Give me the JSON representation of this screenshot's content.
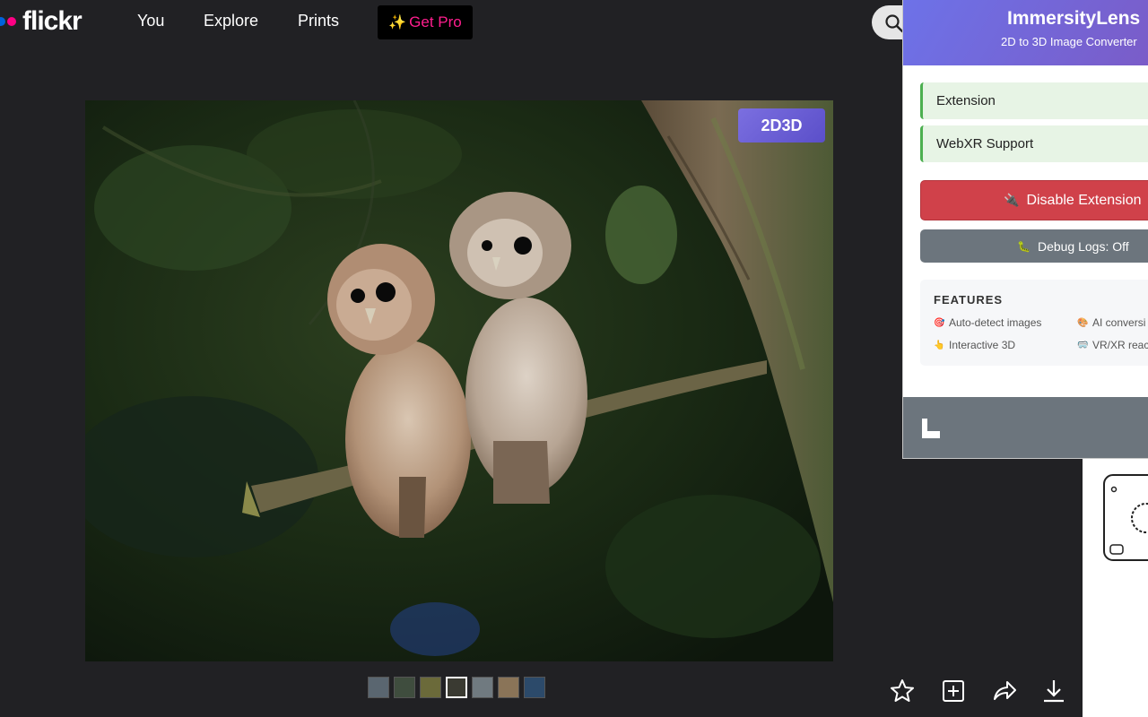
{
  "nav": {
    "logo_text": "flickr",
    "links": [
      "You",
      "Explore",
      "Prints"
    ],
    "get_pro": "Get Pro",
    "get_pro_icon": "sparkles-icon",
    "search_icon": "search-icon"
  },
  "photo": {
    "subject": "two owlets perched on a branch",
    "badge": "2D3D"
  },
  "thumbnails": {
    "count": 7,
    "selected_index": 3
  },
  "actions": [
    "star-icon",
    "add-to-gallery-icon",
    "share-icon",
    "download-icon"
  ],
  "extension": {
    "title": "ImmersityLens",
    "subtitle": "2D to 3D Image Converter",
    "status_rows": [
      "Extension",
      "WebXR Support"
    ],
    "disable_button": "Disable Extension",
    "disable_icon": "plug-icon",
    "debug_button": "Debug Logs: Off",
    "debug_icon": "bug-icon",
    "features_title": "FEATURES",
    "features": [
      {
        "icon": "target-icon",
        "label": "Auto-detect images"
      },
      {
        "icon": "palette-icon",
        "label": "AI conversi"
      },
      {
        "icon": "pointer-icon",
        "label": "Interactive 3D"
      },
      {
        "icon": "vr-headset-icon",
        "label": "VR/XR reac"
      }
    ]
  },
  "colors": {
    "flickr_blue": "#0063dc",
    "flickr_pink": "#ff0084",
    "get_pro_text": "#ff1e8e",
    "disable_red": "#d0414a",
    "debug_gray": "#6c757d",
    "header_gradient_start": "#6d72e8",
    "header_gradient_end": "#7a5cc8"
  }
}
